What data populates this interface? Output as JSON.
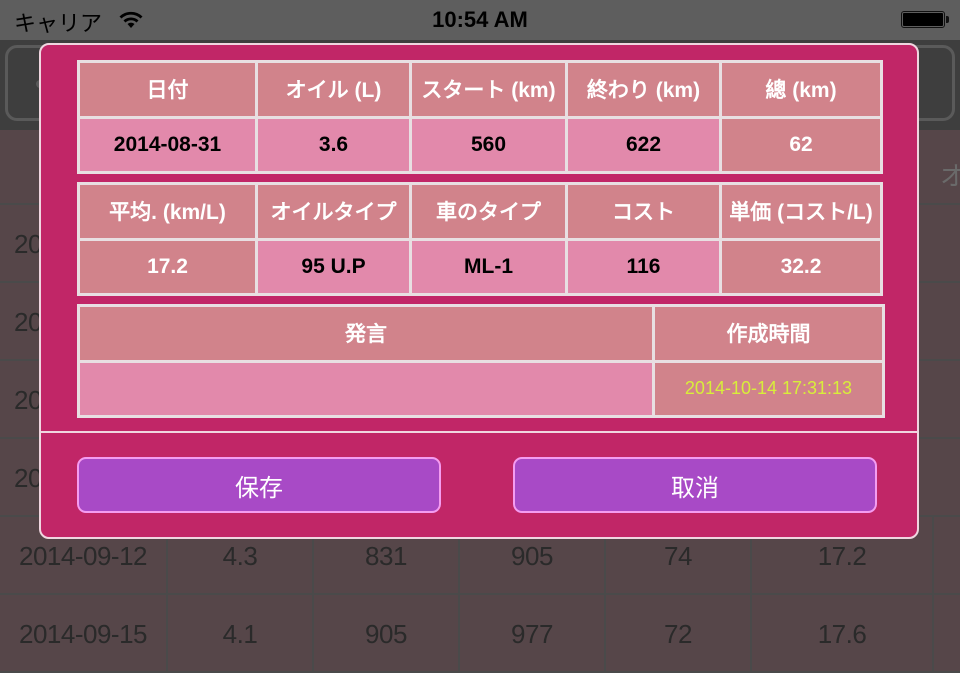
{
  "status_bar": {
    "carrier": "キャリア",
    "time": "10:54 AM",
    "wifi_icon": "wifi-icon",
    "battery_icon": "battery-full-icon"
  },
  "background_table": {
    "partial_header_glyph": "オ",
    "partial_left_text": "20",
    "rows": [
      [
        "2014-09-12",
        "4.3",
        "831",
        "905",
        "74",
        "17.2"
      ],
      [
        "2014-09-15",
        "4.1",
        "905",
        "977",
        "72",
        "17.6"
      ]
    ]
  },
  "modal": {
    "table1": {
      "headers": [
        "日付",
        "オイル (L)",
        "スタート (km)",
        "終わり (km)",
        "總 (km)"
      ],
      "values": [
        "2014-08-31",
        "3.6",
        "560",
        "622",
        "62"
      ]
    },
    "table2": {
      "headers": [
        "平均. (km/L)",
        "オイルタイプ",
        "車のタイプ",
        "コスト",
        "単価 (コスト/L)"
      ],
      "values": [
        "17.2",
        "95 U.P",
        "ML-1",
        "116",
        "32.2"
      ]
    },
    "table3": {
      "headers": [
        "発言",
        "作成時間"
      ],
      "values": [
        "",
        "2014-10-14 17:31:13"
      ]
    },
    "buttons": {
      "save": "保存",
      "cancel": "取消"
    }
  },
  "colors": {
    "modal_bg": "#c12667",
    "header_cell": "#d1838b",
    "editable_cell": "#e289ab",
    "button_bg": "#a84ac6",
    "button_border": "#f49cf0",
    "timestamp_text": "#d8ee3a"
  }
}
